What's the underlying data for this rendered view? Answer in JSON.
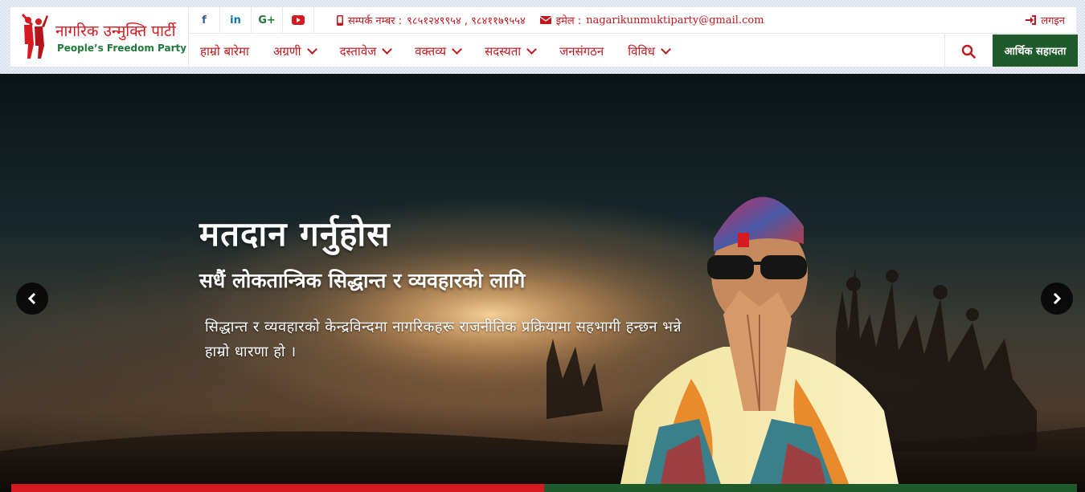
{
  "brand": {
    "name_np": "नागरिक उन्मुक्ति पार्टी",
    "name_en": "People’s Freedom Party"
  },
  "social": [
    {
      "icon": "facebook-icon",
      "glyph": "f",
      "color": "#3b5998"
    },
    {
      "icon": "linkedin-icon",
      "glyph": "in",
      "color": "#0e76a8"
    },
    {
      "icon": "google-plus-icon",
      "glyph": "G+",
      "color": "#1f7a3a"
    },
    {
      "icon": "youtube-icon",
      "glyph": "▶",
      "color": "#d71920"
    }
  ],
  "contact": {
    "phone_label": "सम्पर्क नम्बर :",
    "phone_value": "९८५१२४९९५४ , ९८४११७९५५४",
    "email_label": "इमेल :",
    "email_value": "nagarikunmuktiparty@gmail.com"
  },
  "login_label": "लगइन",
  "menu": [
    {
      "label": "हाम्रो बारेमा",
      "dropdown": false
    },
    {
      "label": "अग्रणी",
      "dropdown": true
    },
    {
      "label": "दस्तावेज",
      "dropdown": true
    },
    {
      "label": "वक्तव्य",
      "dropdown": true
    },
    {
      "label": "सदस्यता",
      "dropdown": true
    },
    {
      "label": "जनसंगठन",
      "dropdown": false
    },
    {
      "label": "विविध",
      "dropdown": true
    }
  ],
  "donate_label": "आर्थिक सहायता",
  "hero": {
    "title": "मतदान गर्नुहोस",
    "subtitle": "सधैं लोकतान्त्रिक सिद्धान्त र व्यवहारको लागि",
    "text": "सिद्धान्त र व्यवहारको केन्द्रविन्दमा नागरिकहरू राजनीतिक प्रक्रियामा सहभागी हन्छन भन्ने हाम्रो धारणा हो ।"
  },
  "colors": {
    "brand_red": "#d71920",
    "brand_green": "#1f5a2a"
  }
}
